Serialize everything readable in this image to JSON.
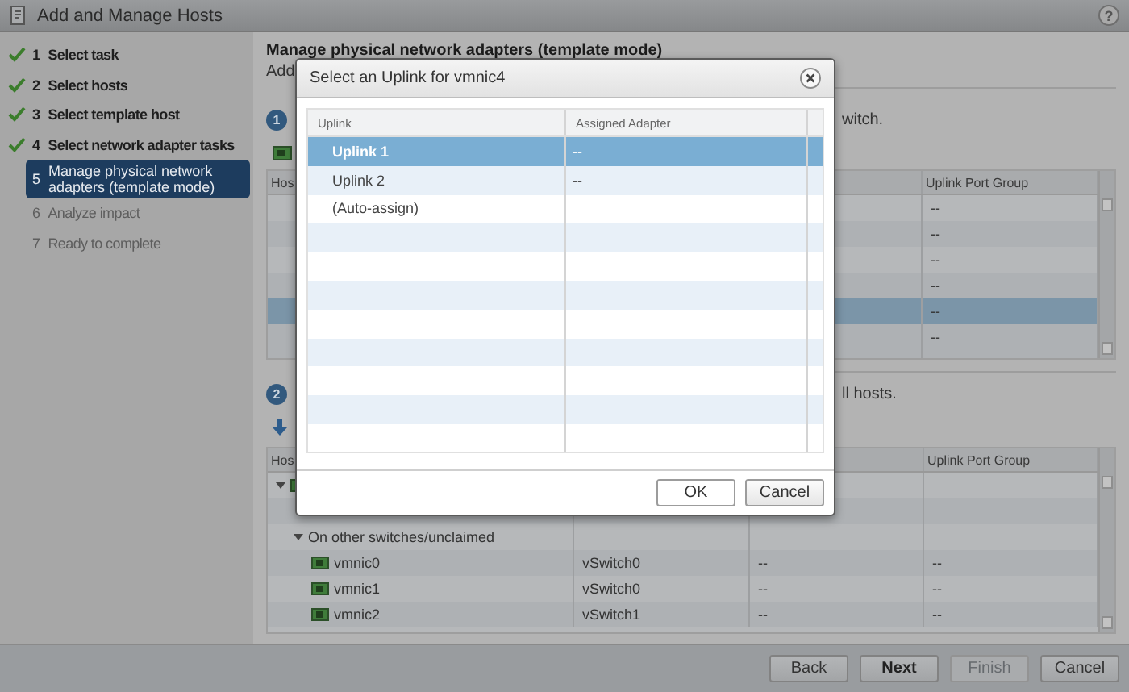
{
  "window": {
    "title": "Add and Manage Hosts",
    "help": "?"
  },
  "steps": [
    {
      "number": "1",
      "label": "Select task",
      "done": true,
      "selected": false
    },
    {
      "number": "2",
      "label": "Select hosts",
      "done": true,
      "selected": false
    },
    {
      "number": "3",
      "label": "Select template host",
      "done": true,
      "selected": false
    },
    {
      "number": "4",
      "label": "Select network adapter tasks",
      "done": true,
      "selected": false
    },
    {
      "number": "5",
      "label": "Manage physical network adapters (template mode)",
      "done": false,
      "selected": true
    },
    {
      "number": "6",
      "label": "Analyze impact",
      "done": false,
      "selected": false
    },
    {
      "number": "7",
      "label": "Ready to complete",
      "done": false,
      "selected": false
    }
  ],
  "page": {
    "title": "Manage physical network adapters (template mode)",
    "subtitle": "Add",
    "section_1": {
      "number": "1",
      "text": "witch.",
      "table": {
        "columns": [
          "Hos",
          "Uplink Port Group"
        ],
        "rows": [
          {
            "uplink_port_group": "--",
            "selected": false
          },
          {
            "uplink_port_group": "--",
            "selected": false
          },
          {
            "uplink_port_group": "--",
            "selected": false
          },
          {
            "uplink_port_group": "--",
            "selected": false
          },
          {
            "uplink_port_group": "--",
            "selected": true
          },
          {
            "uplink_port_group": "--",
            "selected": false
          }
        ]
      }
    },
    "section_2": {
      "number": "2",
      "text": "ll hosts.",
      "table": {
        "columns": [
          "Hos",
          "Uplink Port Group"
        ],
        "rows": [
          {
            "kind": "host",
            "expanded": true,
            "children": [
              {
                "kind": "group",
                "label": "On other switches/unclaimed",
                "expanded": true,
                "children": [
                  {
                    "kind": "adapter",
                    "name": "vmnic0",
                    "switch": "vSwitch0",
                    "column_3": "--",
                    "uplink_port_group": "--"
                  },
                  {
                    "kind": "adapter",
                    "name": "vmnic1",
                    "switch": "vSwitch0",
                    "column_3": "--",
                    "uplink_port_group": "--"
                  },
                  {
                    "kind": "adapter",
                    "name": "vmnic2",
                    "switch": "vSwitch1",
                    "column_3": "--",
                    "uplink_port_group": "--"
                  }
                ]
              }
            ]
          }
        ]
      }
    }
  },
  "dialog": {
    "title": "Select an Uplink for vmnic4",
    "columns": [
      "Uplink",
      "Assigned Adapter"
    ],
    "rows": [
      {
        "uplink": "Uplink 1",
        "assigned_adapter": "--",
        "selected": true
      },
      {
        "uplink": "Uplink 2",
        "assigned_adapter": "--",
        "selected": false
      },
      {
        "uplink": "(Auto-assign)",
        "selected": false
      }
    ],
    "buttons": [
      {
        "label": "OK",
        "default": true
      },
      {
        "label": "Cancel",
        "default": false
      }
    ]
  },
  "footer": {
    "buttons": [
      {
        "label": "Back",
        "primary": false,
        "disabled": false
      },
      {
        "label": "Next",
        "primary": true,
        "disabled": false
      },
      {
        "label": "Finish",
        "primary": false,
        "disabled": true
      },
      {
        "label": "Cancel",
        "primary": false,
        "disabled": false
      }
    ]
  }
}
